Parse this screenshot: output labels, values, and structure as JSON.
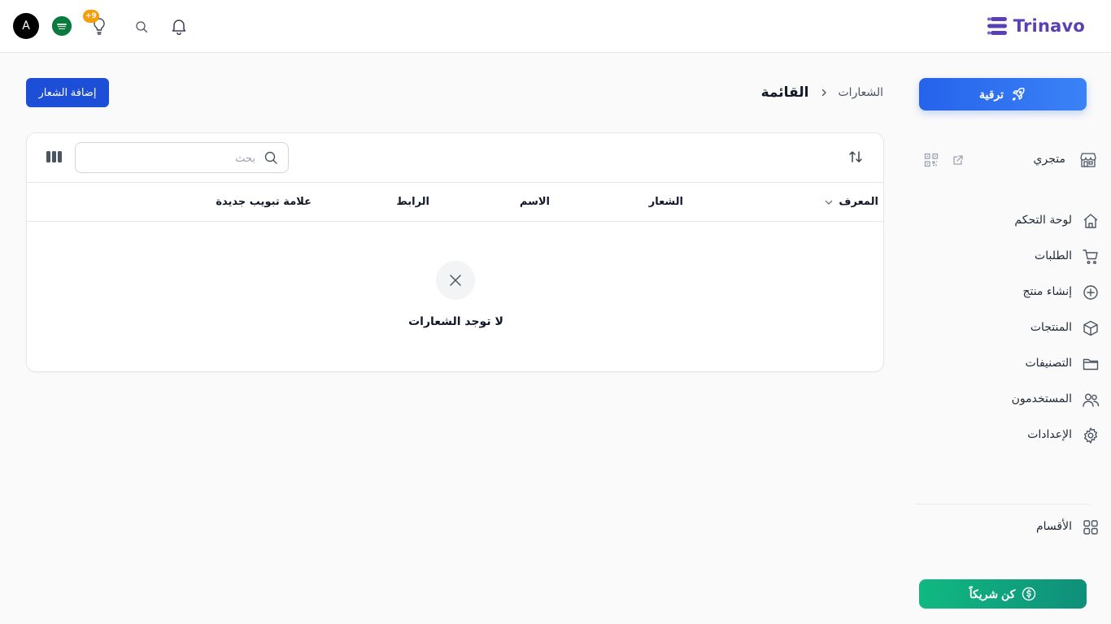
{
  "brand": {
    "name": "Trinavo",
    "color": "#5b3fb5"
  },
  "topbar": {
    "avatar_letter": "A",
    "notifications_badge": "+9"
  },
  "sidebar": {
    "upgrade_label": "ترقية",
    "store_label": "متجري",
    "items": [
      {
        "label": "لوحة التحكم",
        "icon": "home-icon"
      },
      {
        "label": "الطلبات",
        "icon": "cart-icon"
      },
      {
        "label": "إنشاء منتج",
        "icon": "plus-circle-icon"
      },
      {
        "label": "المنتجات",
        "icon": "box-icon"
      },
      {
        "label": "التصنيفات",
        "icon": "folder-icon"
      },
      {
        "label": "المستخدمون",
        "icon": "users-icon"
      },
      {
        "label": "الإعدادات",
        "icon": "gear-icon"
      }
    ],
    "sections_label": "الأقسام",
    "partner_label": "كن شريكاً"
  },
  "breadcrumb": {
    "parent": "الشعارات",
    "current": "القائمة"
  },
  "actions": {
    "add_label": "إضافة الشعار"
  },
  "table": {
    "search_placeholder": "بحث",
    "columns": [
      "المعرف",
      "الشعار",
      "الاسم",
      "الرابط",
      "علامة تبويب جديدة"
    ],
    "empty_text": "لا توجد الشعارات"
  },
  "colors": {
    "primary": "#1d4ed8",
    "upgrade": "#2563eb",
    "partner": "#10b981",
    "badge": "#f59e0b"
  }
}
